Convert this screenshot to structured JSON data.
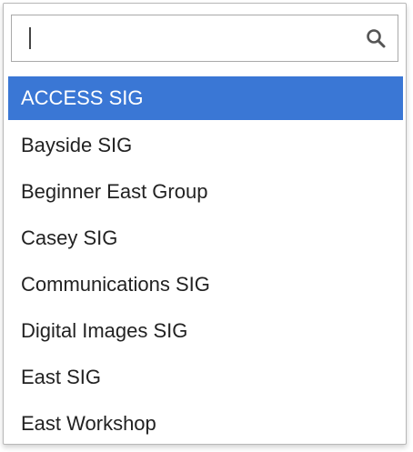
{
  "search": {
    "value": "",
    "placeholder": ""
  },
  "options": [
    {
      "label": "ACCESS SIG",
      "selected": true
    },
    {
      "label": "Bayside SIG",
      "selected": false
    },
    {
      "label": "Beginner East Group",
      "selected": false
    },
    {
      "label": "Casey SIG",
      "selected": false
    },
    {
      "label": "Communications SIG",
      "selected": false
    },
    {
      "label": "Digital Images SIG",
      "selected": false
    },
    {
      "label": "East SIG",
      "selected": false
    },
    {
      "label": "East Workshop",
      "selected": false
    }
  ],
  "colors": {
    "highlight": "#3a77d5",
    "text": "#222222"
  },
  "icons": {
    "search": "search-icon"
  }
}
